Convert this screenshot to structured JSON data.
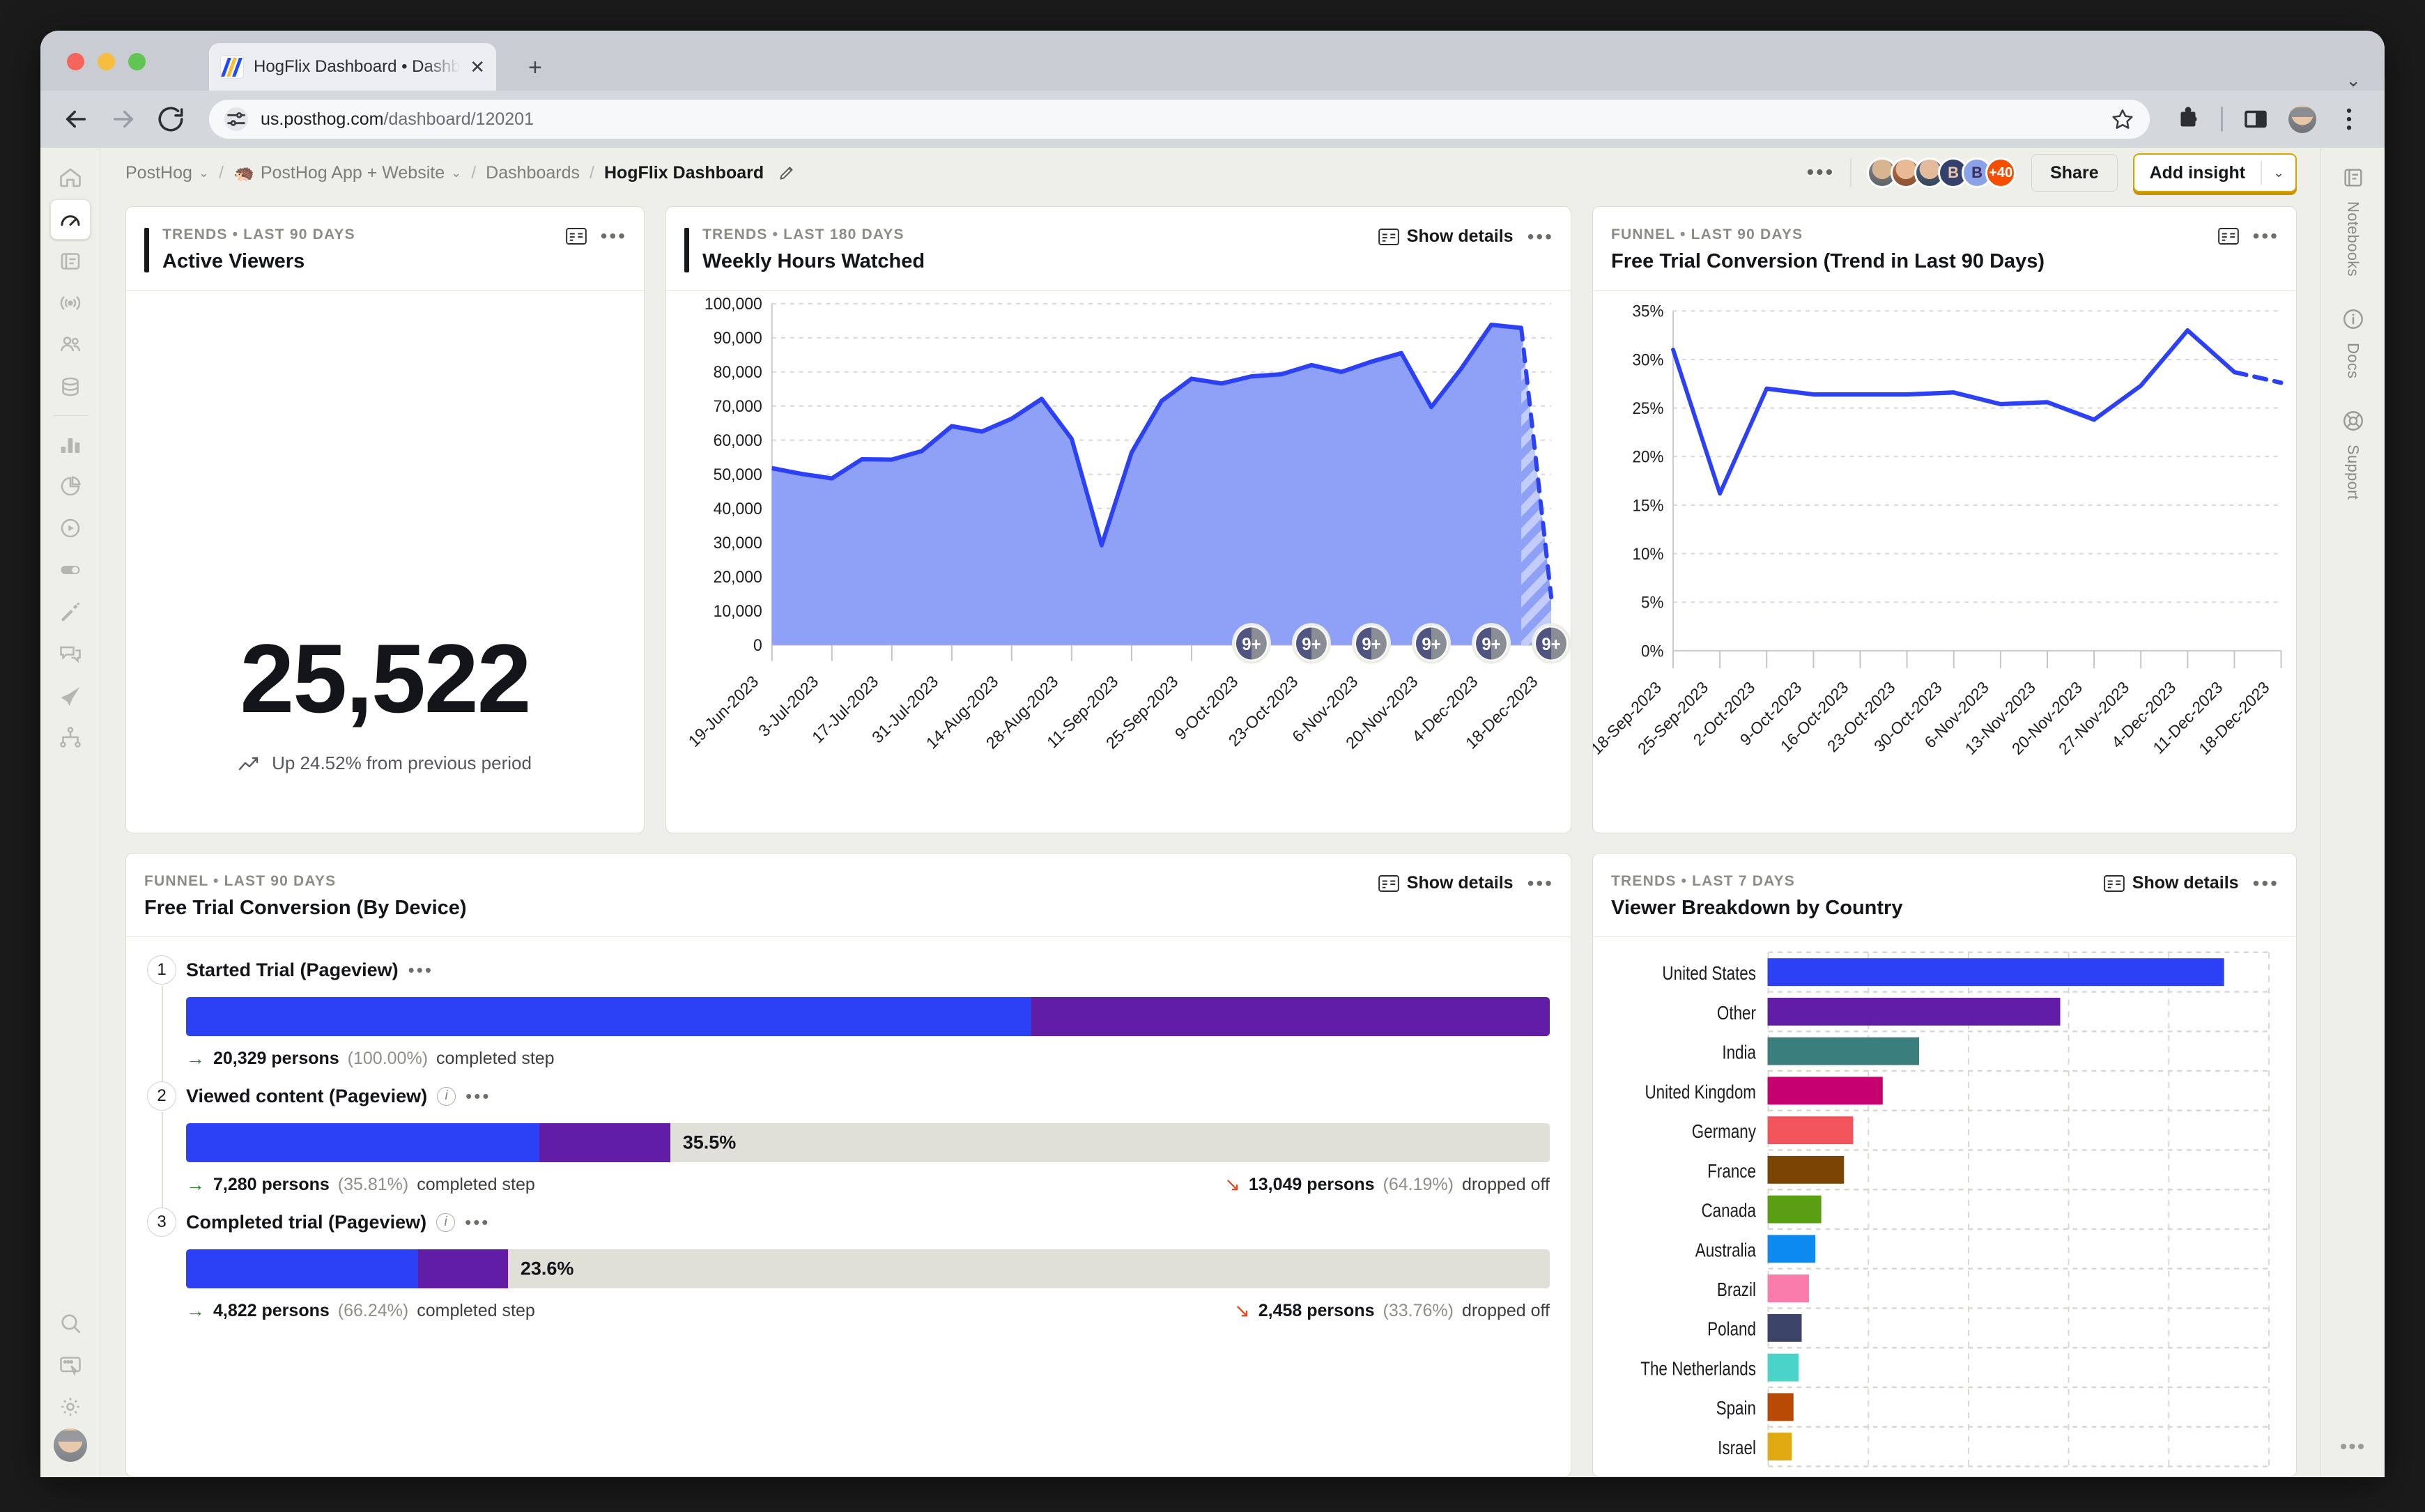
{
  "browser": {
    "tab_title": "HogFlix Dashboard • Dashboa",
    "close_label": "✕",
    "newtab_label": "+",
    "collapse_label": "⌄",
    "url_prefix": "us.posthog.com",
    "url_path": "/dashboard/120201"
  },
  "breadcrumb": {
    "org": "PostHog",
    "project": "PostHog App + Website",
    "project_emoji": "🦔",
    "section": "Dashboards",
    "current": "HogFlix Dashboard",
    "separator": "/",
    "chevron": "⌄"
  },
  "header": {
    "overflow_dots": "•••",
    "avatars": [
      {
        "kind": "photo",
        "label": ""
      },
      {
        "kind": "photo",
        "label": ""
      },
      {
        "kind": "photo",
        "label": ""
      },
      {
        "kind": "initial",
        "label": "B"
      },
      {
        "kind": "initial",
        "label": "B"
      },
      {
        "kind": "more",
        "label": "+40"
      }
    ],
    "share_label": "Share",
    "add_insight_label": "Add insight",
    "add_insight_caret": "⌄"
  },
  "left_nav": {
    "items": [
      {
        "name": "home",
        "active": false
      },
      {
        "name": "dashboards",
        "active": true
      },
      {
        "name": "notebooks",
        "active": false
      },
      {
        "name": "events-live",
        "active": false
      },
      {
        "name": "persons",
        "active": false
      },
      {
        "name": "data-management",
        "active": false
      },
      {
        "name": "product-analytics",
        "active": false
      },
      {
        "name": "web-analytics",
        "active": false
      },
      {
        "name": "session-replay",
        "active": false
      },
      {
        "name": "feature-flags",
        "active": false
      },
      {
        "name": "experiments",
        "active": false
      },
      {
        "name": "surveys",
        "active": false
      },
      {
        "name": "early-access",
        "active": false
      },
      {
        "name": "pipeline",
        "active": false
      }
    ],
    "bottom_items": [
      {
        "name": "search"
      },
      {
        "name": "toolbar"
      },
      {
        "name": "settings"
      }
    ]
  },
  "right_nav": {
    "items": [
      {
        "label": "Notebooks",
        "icon": "notebook-icon"
      },
      {
        "label": "Docs",
        "icon": "info-icon"
      },
      {
        "label": "Support",
        "icon": "lifebuoy-icon"
      }
    ],
    "overflow_dots": "•••"
  },
  "cards": {
    "active_viewers": {
      "kicker": "TRENDS • LAST 90 DAYS",
      "title": "Active Viewers",
      "value": "25,522",
      "delta": "Up 24.52% from previous period",
      "dots": "•••"
    },
    "weekly_hours": {
      "kicker": "TRENDS • LAST 180 DAYS",
      "title": "Weekly Hours Watched",
      "show_details": "Show details",
      "dots": "•••",
      "annotation_badge": "9+"
    },
    "trial_trend": {
      "kicker": "FUNNEL • LAST 90 DAYS",
      "title": "Free Trial Conversion (Trend in Last 90 Days)",
      "dots": "•••"
    },
    "trial_device": {
      "kicker": "FUNNEL • LAST 90 DAYS",
      "title": "Free Trial Conversion (By Device)",
      "show_details": "Show details",
      "dots": "•••",
      "steps": [
        {
          "index": "1",
          "name": "Started Trial (Pageview)",
          "has_info": false,
          "dots": "•••",
          "bar_pct": 100.0,
          "seg_a_pct": 62.0,
          "label": "",
          "completed_arrow": "→",
          "completed_count": "20,329 persons",
          "completed_pct": "(100.00%)",
          "completed_suffix": "completed step",
          "dropped_arrow": "",
          "dropped_count": "",
          "dropped_pct": "",
          "dropped_suffix": ""
        },
        {
          "index": "2",
          "name": "Viewed content (Pageview)",
          "has_info": true,
          "dots": "•••",
          "bar_pct": 35.5,
          "seg_a_pct": 73.0,
          "label": "35.5%",
          "completed_arrow": "→",
          "completed_count": "7,280 persons",
          "completed_pct": "(35.81%)",
          "completed_suffix": "completed step",
          "dropped_arrow": "↘",
          "dropped_count": "13,049 persons",
          "dropped_pct": "(64.19%)",
          "dropped_suffix": "dropped off"
        },
        {
          "index": "3",
          "name": "Completed trial (Pageview)",
          "has_info": true,
          "dots": "•••",
          "bar_pct": 23.6,
          "seg_a_pct": 72.0,
          "label": "23.6%",
          "completed_arrow": "→",
          "completed_count": "4,822 persons",
          "completed_pct": "(66.24%)",
          "completed_suffix": "completed step",
          "dropped_arrow": "↘",
          "dropped_count": "2,458 persons",
          "dropped_pct": "(33.76%)",
          "dropped_suffix": "dropped off"
        }
      ]
    },
    "country_breakdown": {
      "kicker": "TRENDS • LAST 7 DAYS",
      "title": "Viewer Breakdown by Country",
      "show_details": "Show details",
      "dots": "•••"
    }
  },
  "chart_data": [
    {
      "id": "weekly_hours_watched",
      "type": "area",
      "title": "Weekly Hours Watched",
      "xlabel": "",
      "ylabel": "",
      "ylim": [
        0,
        100000
      ],
      "yticks": [
        0,
        10000,
        20000,
        30000,
        40000,
        50000,
        60000,
        70000,
        80000,
        90000,
        100000
      ],
      "ytick_labels": [
        "0",
        "10,000",
        "20,000",
        "30,000",
        "40,000",
        "50,000",
        "60,000",
        "70,000",
        "80,000",
        "90,000",
        "100,000"
      ],
      "grid": true,
      "x_tick_labels": [
        "19-Jun-2023",
        "3-Jul-2023",
        "17-Jul-2023",
        "31-Jul-2023",
        "14-Aug-2023",
        "28-Aug-2023",
        "11-Sep-2023",
        "25-Sep-2023",
        "9-Oct-2023",
        "23-Oct-2023",
        "6-Nov-2023",
        "20-Nov-2023",
        "4-Dec-2023",
        "18-Dec-2023"
      ],
      "values": [
        51800,
        50100,
        48800,
        54400,
        54300,
        56800,
        64100,
        62500,
        66300,
        72100,
        60400,
        29200,
        56400,
        71500,
        78000,
        76600,
        78700,
        79300,
        82000,
        80000,
        83000,
        85500,
        69700,
        81000,
        93800,
        92900,
        14000
      ],
      "line_color": "#2c41f5",
      "fill_color": "#8ea1f7",
      "projection_from_index": 25,
      "annotation_badges": 6,
      "annotation_badge_text": "9+"
    },
    {
      "id": "free_trial_conversion_trend",
      "type": "line",
      "title": "Free Trial Conversion (Trend in Last 90 Days)",
      "xlabel": "",
      "ylabel": "",
      "ylim": [
        0,
        35
      ],
      "yticks": [
        0,
        5,
        10,
        15,
        20,
        25,
        30,
        35
      ],
      "ytick_labels": [
        "0%",
        "5%",
        "10%",
        "15%",
        "20%",
        "25%",
        "30%",
        "35%"
      ],
      "grid": true,
      "x_tick_labels": [
        "18-Sep-2023",
        "25-Sep-2023",
        "2-Oct-2023",
        "9-Oct-2023",
        "16-Oct-2023",
        "23-Oct-2023",
        "30-Oct-2023",
        "6-Nov-2023",
        "13-Nov-2023",
        "20-Nov-2023",
        "27-Nov-2023",
        "4-Dec-2023",
        "11-Dec-2023",
        "18-Dec-2023"
      ],
      "values": [
        31.0,
        16.2,
        27.0,
        26.4,
        26.4,
        26.4,
        26.6,
        25.4,
        25.6,
        23.8,
        27.3,
        33.0,
        28.7,
        27.6
      ],
      "line_color": "#2c41f5",
      "dashed_from_index": 12
    },
    {
      "id": "viewer_breakdown_by_country",
      "type": "bar",
      "orientation": "horizontal",
      "title": "Viewer Breakdown by Country",
      "xlabel": "",
      "ylabel": "",
      "grid": true,
      "categories": [
        "United States",
        "Other",
        "India",
        "United Kingdom",
        "Germany",
        "France",
        "Canada",
        "Australia",
        "Brazil",
        "Poland",
        "The Netherlands",
        "Spain",
        "Israel"
      ],
      "values": [
        100,
        64,
        33,
        25,
        18.5,
        16.5,
        11.5,
        10.2,
        8.8,
        7.2,
        6.5,
        5.4,
        5.0
      ],
      "colors": [
        "#2c41f5",
        "#621da6",
        "#3a7f7d",
        "#c6006f",
        "#f2545b",
        "#7a4405",
        "#5a9e14",
        "#0d8af0",
        "#fa7caa",
        "#3b4369",
        "#4ad4c9",
        "#b84a06",
        "#e0a912"
      ]
    }
  ]
}
